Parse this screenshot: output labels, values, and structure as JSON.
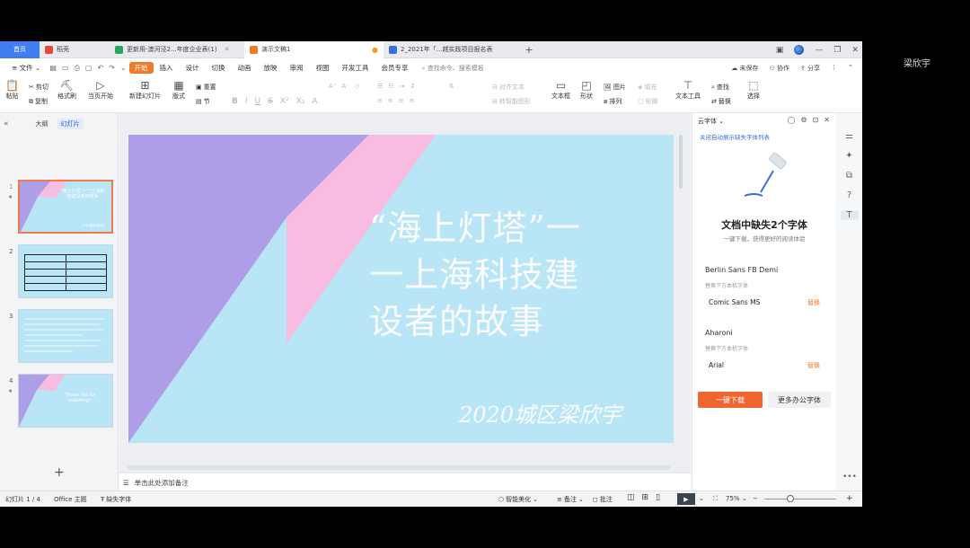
{
  "overlay": {
    "user_name": "梁欣宇"
  },
  "tabs": [
    {
      "label": "首页",
      "kind": "home"
    },
    {
      "label": "稻壳",
      "icon": "docer-icon",
      "color": "#e8483b"
    },
    {
      "label": "更新用-澳河泾2...年度企业表(1)",
      "icon": "sheet-icon",
      "color": "#2aa55e"
    },
    {
      "label": "演示文稿1",
      "icon": "slides-icon",
      "color": "#f07a2a",
      "active": true
    },
    {
      "label": "2_2021年「...越实践项目报名表",
      "icon": "word-icon",
      "color": "#3b6fd8"
    }
  ],
  "menubar": {
    "file": "文件",
    "items": [
      "开始",
      "插入",
      "设计",
      "切换",
      "动画",
      "放映",
      "审阅",
      "视图",
      "开发工具",
      "会员专享"
    ],
    "search": "查找命令、搜索模板",
    "right": [
      "未保存",
      "协作",
      "分享"
    ]
  },
  "ribbon": {
    "paste": "粘贴",
    "cut": "剪切",
    "copy": "复制",
    "format_painter": "格式刷",
    "play_from_current": "当页开始",
    "new_slide": "新建幻灯片",
    "layout": "版式",
    "reset": "重置",
    "section": "节",
    "text_direction": "文字方向",
    "align_text": "对齐文本",
    "smart_graphic": "转智能图形",
    "textbox": "文本框",
    "shape": "形状",
    "picture": "图片",
    "fill": "填充",
    "arrange": "排列",
    "outline": "轮廓",
    "text_tools": "文本工具",
    "find": "查找",
    "replace": "替换",
    "select": "选择"
  },
  "left_panel": {
    "tabs": [
      "大纲",
      "幻灯片"
    ],
    "slides": [
      {
        "num": "1",
        "title": "\"海上灯塔\"一一上海科技建设者的故事",
        "author": "2020城区梁欣宇",
        "selected": true
      },
      {
        "num": "2"
      },
      {
        "num": "3"
      },
      {
        "num": "4",
        "text": "Thank You for watching！"
      }
    ]
  },
  "slide": {
    "title": "“海上灯塔”一一上海科技建设者的故事",
    "title_lines": [
      "“海上灯塔”一",
      "一上海科技建",
      "设者的故事"
    ],
    "subtitle": "2020城区梁欣宇",
    "colors": {
      "background": "#b8e6f6",
      "purple": "#ae9ee8",
      "pink": "#f8bce0"
    }
  },
  "notes": {
    "placeholder": "单击此处添加备注"
  },
  "right_panel": {
    "header": "云字体",
    "link": "关闭自动展示缺失字体列表",
    "title": "文档中缺失2个字体",
    "subtitle": "一键下载，获得更好的阅读体验",
    "fonts": [
      {
        "name": "Berlin Sans FB Demi",
        "hint": "替换下方本机字体",
        "replacement": "Comic Sans MS",
        "action": "替换"
      },
      {
        "name": "Aharoni",
        "hint": "替换下方本机字体",
        "replacement": "Arial",
        "action": "替换"
      }
    ],
    "download_button": "一键下载",
    "more_button": "更多办公字体"
  },
  "status_bar": {
    "slide_counter": "幻灯片 1 / 4",
    "theme": "Office 主题",
    "missing_fonts": "缺失字体",
    "beautify": "智能美化",
    "notes": "备注",
    "comments": "批注",
    "zoom": "75%"
  }
}
